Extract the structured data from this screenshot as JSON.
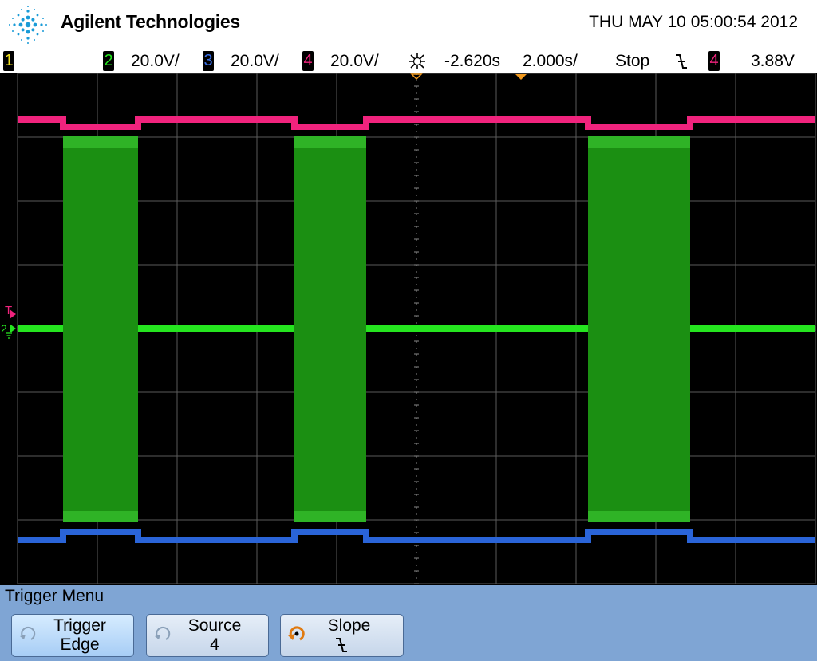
{
  "header": {
    "brand": "Agilent Technologies",
    "datetime": "THU MAY 10 05:00:54 2012"
  },
  "status_bar": {
    "ch1_num": "1",
    "ch2_num": "2",
    "ch2_scale": "20.0V/",
    "ch3_num": "3",
    "ch3_scale": "20.0V/",
    "ch4_num": "4",
    "ch4_scale": "20.0V/",
    "delay": "-2.620s",
    "timebase": "2.000s/",
    "run_state": "Stop",
    "slope_symbol": "f",
    "trig_source_num": "4",
    "trig_level": "3.88V"
  },
  "markers": {
    "trigger_letter": "T",
    "ch2_ground_num": "2"
  },
  "menu": {
    "title": "Trigger Menu",
    "softkeys": [
      {
        "label": "Trigger",
        "value": "Edge",
        "icon": "rotate-knob-icon"
      },
      {
        "label": "Source",
        "value": "4",
        "icon": "rotate-knob-icon"
      },
      {
        "label": "Slope",
        "value": "f",
        "icon": "entry-knob-icon"
      }
    ]
  },
  "colors": {
    "ch1": "#f0e020",
    "ch2": "#25e51f",
    "ch2_burst": "#1b8f12",
    "ch3": "#2a64d8",
    "ch4": "#f0237d",
    "menu_bg": "#7fa5d4",
    "trigger_marker": "#f39a1e"
  },
  "waveforms": {
    "burst_intervals_s": [
      [
        -8.65,
        -6.8
      ],
      [
        -2.85,
        -1.05
      ],
      [
        4.5,
        7.0
      ]
    ],
    "screen_time_range_s": [
      -12.62,
      7.38
    ]
  }
}
